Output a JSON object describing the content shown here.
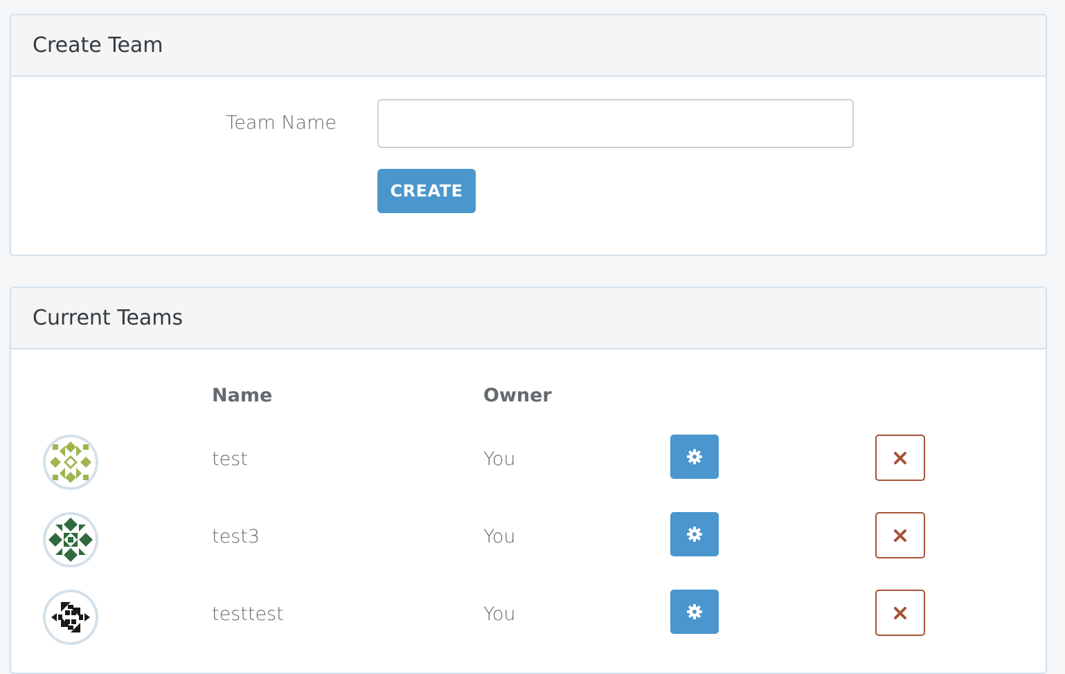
{
  "create_team": {
    "title": "Create Team",
    "name_label": "Team Name",
    "name_value": "",
    "name_placeholder": "",
    "create_button": "CREATE"
  },
  "current_teams": {
    "title": "Current Teams",
    "columns": {
      "name": "Name",
      "owner": "Owner"
    },
    "rows": [
      {
        "name": "test",
        "owner": "You",
        "avatar_color": "#9fb650",
        "avatar_icon": "identicon"
      },
      {
        "name": "test3",
        "owner": "You",
        "avatar_color": "#2f6b3d",
        "avatar_icon": "identicon"
      },
      {
        "name": "testtest",
        "owner": "You",
        "avatar_color": "#1a1a1a",
        "avatar_icon": "identicon"
      }
    ]
  },
  "colors": {
    "primary": "#4a96cd",
    "danger": "#a55337",
    "panel_border": "#d3e0e9"
  },
  "icons": {
    "settings": "gear-icon",
    "delete": "close-icon"
  }
}
